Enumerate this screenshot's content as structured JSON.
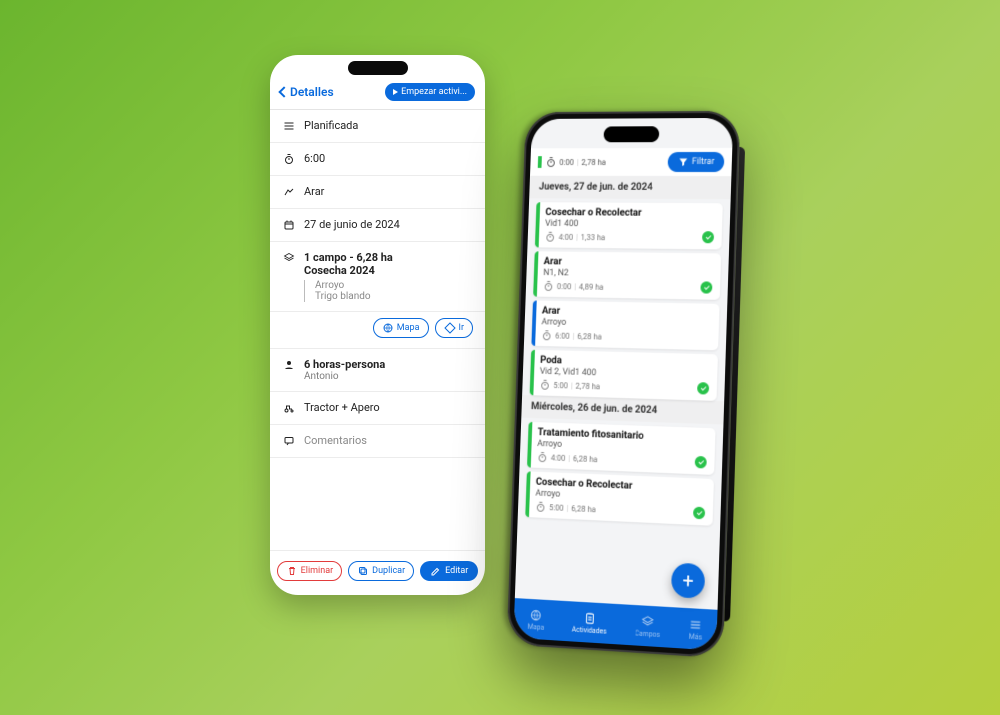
{
  "phone1": {
    "back_label": "Detalles",
    "start_label": "Empezar activi...",
    "rows": {
      "status": "Planificada",
      "time": "6:00",
      "type": "Arar",
      "date": "27 de junio de 2024",
      "field_title": "1 campo - 6,28 ha",
      "field_season": "Cosecha 2024",
      "field_name": "Arroyo",
      "field_crop": "Trigo blando",
      "hours": "6 horas-persona",
      "worker": "Antonio",
      "equipment": "Tractor + Apero",
      "comments": "Comentarios"
    },
    "map_btn": "Mapa",
    "go_btn": "Ir",
    "delete_btn": "Eliminar",
    "duplicate_btn": "Duplicar",
    "edit_btn": "Editar"
  },
  "phone2": {
    "summary_time": "0:00",
    "summary_area": "2,78 ha",
    "filter_btn": "Filtrar",
    "group1_date": "Jueves, 27 de jun. de 2024",
    "group2_date": "Miércoles, 26 de jun. de 2024",
    "cards": [
      {
        "accent": "green",
        "title": "Cosechar o Recolectar",
        "loc": "Vid1 400",
        "time": "4:00",
        "area": "1,33 ha",
        "done": true
      },
      {
        "accent": "green",
        "title": "Arar",
        "loc": "N1, N2",
        "time": "0:00",
        "area": "4,89 ha",
        "done": true
      },
      {
        "accent": "blue",
        "title": "Arar",
        "loc": "Arroyo",
        "time": "6:00",
        "area": "6,28 ha",
        "done": false
      },
      {
        "accent": "green",
        "title": "Poda",
        "loc": "Vid 2, Vid1 400",
        "time": "5:00",
        "area": "2,78 ha",
        "done": true
      },
      {
        "accent": "green",
        "title": "Tratamiento fitosanitario",
        "loc": "Arroyo",
        "time": "4:00",
        "area": "6,28 ha",
        "done": true
      },
      {
        "accent": "green",
        "title": "Cosechar o Recolectar",
        "loc": "Arroyo",
        "time": "5:00",
        "area": "6,28 ha",
        "done": true
      }
    ],
    "tabs": {
      "maps": "Mapa",
      "activities": "Actividades",
      "fields": "Campos",
      "more": "Más"
    }
  }
}
